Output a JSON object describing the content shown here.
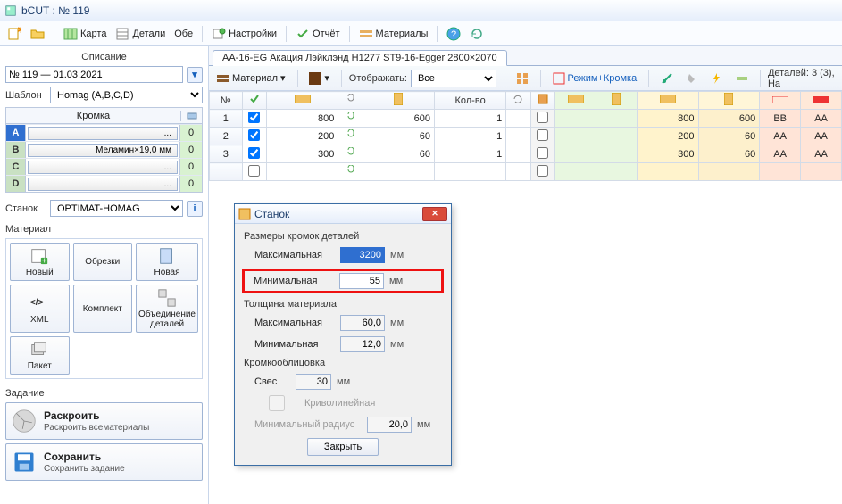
{
  "title": "bCUT : № 119",
  "toolbar": {
    "karta": "Карта",
    "detali": "Детали",
    "obe": "Обе",
    "nastroyki": "Настройки",
    "otchet": "Отчёт",
    "materialy": "Материалы"
  },
  "left": {
    "opisanie_label": "Описание",
    "opisanie_value": "№ 119 — 01.03.2021",
    "shablon_label": "Шаблон",
    "shablon_value": "Homag (A,B,C,D)",
    "kromka_label": "Кромка",
    "kromka_rows": [
      {
        "id": "A",
        "name": "...",
        "qty": "0",
        "sel": true
      },
      {
        "id": "B",
        "name": "Меламин×19,0 мм",
        "qty": "0",
        "sel": false
      },
      {
        "id": "C",
        "name": "...",
        "qty": "0",
        "sel": false
      },
      {
        "id": "D",
        "name": "...",
        "qty": "0",
        "sel": false
      }
    ],
    "stanok_label": "Станок",
    "stanok_value": "OPTIMAT-HOMAG",
    "material_label": "Материал",
    "btn_noviy": "Новый",
    "btn_obrezki": "Обрезки",
    "btn_novaya": "Новая",
    "btn_xml": "XML",
    "btn_obyed": "Объединение деталей",
    "btn_komplekt": "Комплект",
    "btn_paket": "Пакет",
    "zadanie_label": "Задание",
    "raskroit_title": "Раскроить",
    "raskroit_sub": "Раскроить всематериалы",
    "sohranit_title": "Сохранить",
    "sohranit_sub": "Сохранить задание"
  },
  "right": {
    "tab": "AA-16-EG Акация Лэйклэнд H1277 ST9-16-Egger 2800×2070",
    "material_btn": "Материал",
    "otobr_label": "Отображать:",
    "otobr_value": "Все",
    "rezhim": "Режим+Кромка",
    "status": "Деталей: 3  (3), На",
    "cols": {
      "num": "№",
      "kolvo": "Кол-во"
    },
    "rows": [
      {
        "n": "1",
        "chk": true,
        "w": "800",
        "h": "600",
        "qty": "1",
        "w2": "800",
        "h2": "600",
        "e1": "BB",
        "e2": "AA"
      },
      {
        "n": "2",
        "chk": true,
        "w": "200",
        "h": "60",
        "qty": "1",
        "w2": "200",
        "h2": "60",
        "e1": "AA",
        "e2": "AA"
      },
      {
        "n": "3",
        "chk": true,
        "w": "300",
        "h": "60",
        "qty": "1",
        "w2": "300",
        "h2": "60",
        "e1": "AA",
        "e2": "AA"
      }
    ]
  },
  "modal": {
    "title": "Станок",
    "g1": "Размеры кромок деталей",
    "max_label": "Максимальная",
    "max_val": "3200",
    "min_label": "Минимальная",
    "min_val": "55",
    "mm": "мм",
    "g2": "Толщина материала",
    "tmax_label": "Максимальная",
    "tmax_val": "60,0",
    "tmin_label": "Минимальная",
    "tmin_val": "12,0",
    "g3": "Кромкооблицовка",
    "sves_label": "Свес",
    "sves_val": "30",
    "krivo": "Криволинейная",
    "minrad_label": "Минимальный радиус",
    "minrad_val": "20,0",
    "close": "Закрыть"
  }
}
